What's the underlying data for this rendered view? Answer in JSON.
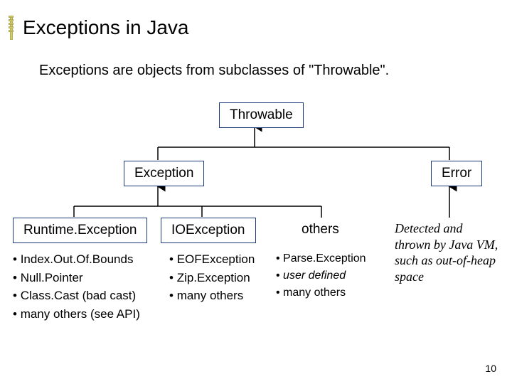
{
  "title": "Exceptions in Java",
  "subtitle": "Exceptions are objects from subclasses of \"Throwable\".",
  "tree": {
    "root": "Throwable",
    "left": "Exception",
    "right": "Error",
    "runtime": "Runtime.Exception",
    "io": "IOException",
    "others_label": "others"
  },
  "runtime_items": [
    "Index.Out.Of.Bounds",
    "Null.Pointer",
    "Class.Cast (bad cast)",
    "many others (see API)"
  ],
  "io_items": [
    "EOFException",
    "Zip.Exception",
    "many others"
  ],
  "others_items": [
    "Parse.Exception",
    "user defined",
    "many others"
  ],
  "error_note": "Detected and thrown by Java VM, such as out-of-heap space",
  "page_number": "10"
}
